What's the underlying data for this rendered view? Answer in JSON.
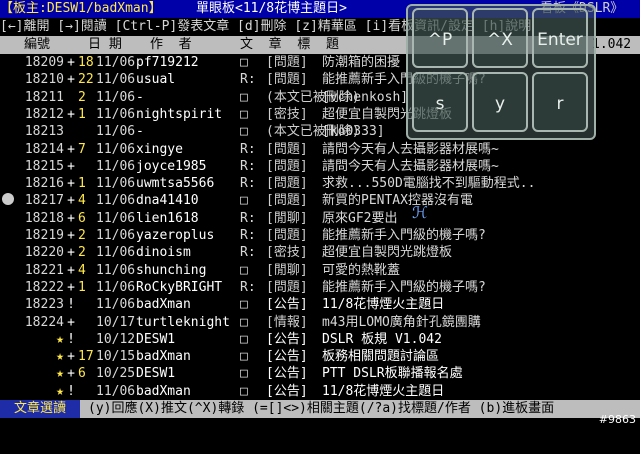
{
  "header": {
    "left": "【板主:DESW1/badXman】",
    "mid": "單眼板<11/8花博主題日>",
    "right": "看板《DSLR》"
  },
  "help": "[←]離開 [→]閱讀 [Ctrl-P]發表文章 [d]刪除 [z]精華區 [i]看板資訊/設定 [h]說明",
  "columns": {
    "num": "編號",
    "date": "日 期",
    "author": "作  者",
    "title": "文  章  標  題",
    "extra": "1.042"
  },
  "rows": [
    {
      "num": "18209",
      "mk": "+",
      "cnt": "18",
      "date": "11/06",
      "author": "pf719212",
      "rp": "□",
      "cat": "[問題]",
      "title": "防潮箱的困擾"
    },
    {
      "num": "18210",
      "mk": "+",
      "cnt": "22",
      "date": "11/06",
      "author": "usual",
      "rp": "R:",
      "cat": "[問題]",
      "title": "能推薦新手入門級的機子嗎?"
    },
    {
      "num": "18211",
      "mk": "",
      "cnt": "2",
      "date": "11/06",
      "author": "-",
      "rp": "□",
      "cat": "(本文已被刪除)",
      "title": "[vchenkosh]"
    },
    {
      "num": "18212",
      "mk": "+",
      "cnt": "1",
      "date": "11/06",
      "author": "nightspirit",
      "rp": "□",
      "cat": "[密技]",
      "title": "超便宜自製閃光跳燈板"
    },
    {
      "num": "18213",
      "mk": "",
      "cnt": "",
      "date": "11/06",
      "author": "-",
      "rp": "□",
      "cat": "(本文已被刪除)",
      "title": "[ko0333]"
    },
    {
      "num": "18214",
      "mk": "+",
      "cnt": "7",
      "date": "11/06",
      "author": "xingye",
      "rp": "R:",
      "cat": "[問題]",
      "title": "請問今天有人去攝影器材展嗎~"
    },
    {
      "num": "18215",
      "mk": "+",
      "cnt": "",
      "date": "11/06",
      "author": "joyce1985",
      "rp": "R:",
      "cat": "[問題]",
      "title": "請問今天有人去攝影器材展嗎~"
    },
    {
      "num": "18216",
      "mk": "+",
      "cnt": "1",
      "date": "11/06",
      "author": "uwmtsa5566",
      "rp": "R:",
      "cat": "[問題]",
      "title": "求救...550D電腦找不到驅動程式.."
    },
    {
      "num": "18217",
      "mk": "+",
      "cnt": "4",
      "date": "11/06",
      "author": "dna41410",
      "rp": "□",
      "cat": "[問題]",
      "title": "新買的PENTAX控器沒有電"
    },
    {
      "num": "18218",
      "mk": "+",
      "cnt": "6",
      "date": "11/06",
      "author": "lien1618",
      "rp": "R:",
      "cat": "[閒聊]",
      "title": "原來GF2要出"
    },
    {
      "num": "18219",
      "mk": "+",
      "cnt": "2",
      "date": "11/06",
      "author": "yazeroplus",
      "rp": "R:",
      "cat": "[問題]",
      "title": "能推薦新手入門級的機子嗎?"
    },
    {
      "num": "18220",
      "mk": "+",
      "cnt": "2",
      "date": "11/06",
      "author": "dinoism",
      "rp": "R:",
      "cat": "[密技]",
      "title": "超便宜自製閃光跳燈板"
    },
    {
      "num": "18221",
      "mk": "+",
      "cnt": "4",
      "date": "11/06",
      "author": "shunching",
      "rp": "□",
      "cat": "[閒聊]",
      "title": "可愛的熱靴蓋"
    },
    {
      "num": "18222",
      "mk": "+",
      "cnt": "1",
      "date": "11/06",
      "author": "RoCkyBRIGHT",
      "rp": "R:",
      "cat": "[問題]",
      "title": "能推薦新手入門級的機子嗎?"
    },
    {
      "num": "18223",
      "mk": "!",
      "cnt": "",
      "date": "11/06",
      "author": "badXman",
      "rp": "□",
      "cat": "[公告]",
      "title": "11/8花博煙火主題日"
    },
    {
      "num": "18224",
      "mk": "+",
      "cnt": "",
      "date": "10/17",
      "author": "turtleknight",
      "rp": "□",
      "cat": "[情報]",
      "title": "m43用LOMO廣角針孔鏡團購"
    },
    {
      "num": "★",
      "mk": "!",
      "cnt": "",
      "date": "10/12",
      "author": "DESW1",
      "rp": "□",
      "cat": "[公告]",
      "title": "DSLR 板規 V1.042"
    },
    {
      "num": "★",
      "mk": "+",
      "cnt": "17",
      "date": "10/15",
      "author": "badXman",
      "rp": "□",
      "cat": "[公告]",
      "title": "板務相關問題討論區"
    },
    {
      "num": "★",
      "mk": "+",
      "cnt": "6",
      "date": "10/25",
      "author": "DESW1",
      "rp": "□",
      "cat": "[公告]",
      "title": "PTT DSLR板聯播報名處"
    },
    {
      "num": "★",
      "mk": "!",
      "cnt": "",
      "date": "11/06",
      "author": "badXman",
      "rp": "□",
      "cat": "[公告]",
      "title": "11/8花博煙火主題日"
    }
  ],
  "footer": {
    "label": "文章選讀",
    "text": "(y)回應(X)推文(^X)轉錄 (=[]<>)相關主題(/?a)找標題/作者 (b)進板畫面"
  },
  "watermark": "#9863",
  "keypad": {
    "k1": "^P",
    "k2": "^X",
    "k3": "Enter",
    "k4": "s",
    "k5": "y",
    "k6": "r"
  },
  "handle_glyph": "ℋ"
}
